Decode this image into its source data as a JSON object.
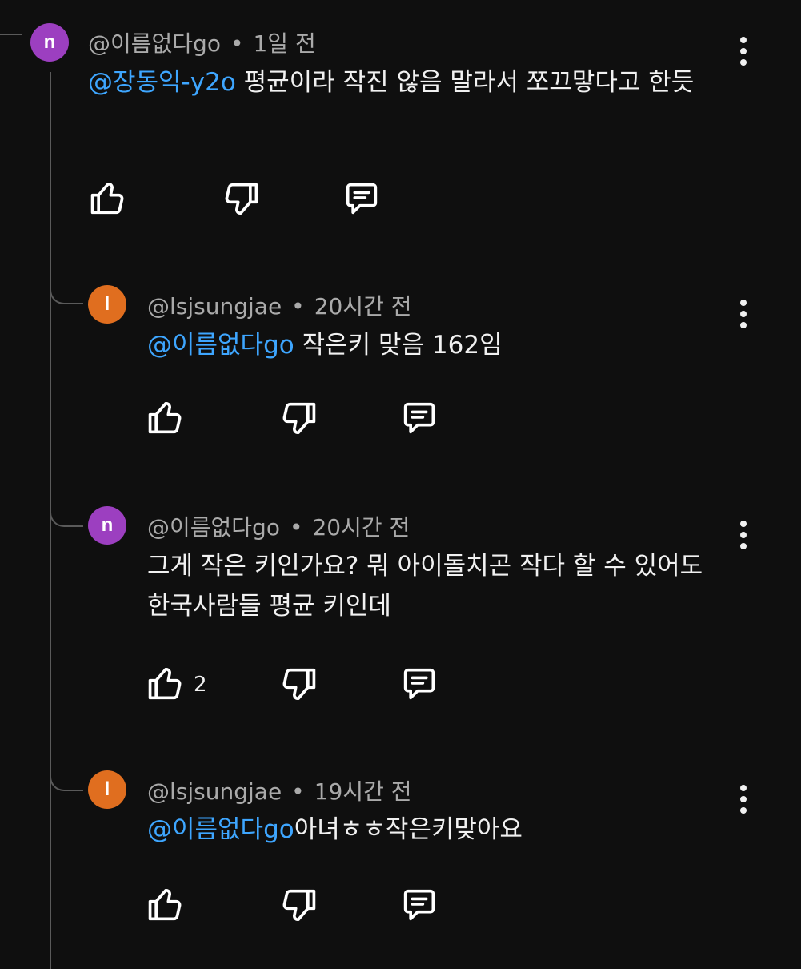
{
  "colors": {
    "background": "#0f0f0f",
    "mention": "#3ea6ff",
    "meta": "#aaaaaa",
    "purple_avatar": "#9c3fc0",
    "orange_avatar": "#e06e1f"
  },
  "comments": [
    {
      "avatar_letter": "n",
      "avatar_color": "#9c3fc0",
      "author": "@이름없다go",
      "separator": "•",
      "time": "1일 전",
      "mention": "@장동익-y2o",
      "text": " 평균이라 작진 않음 말라서 쪼끄맣다고 한듯",
      "like_count": "",
      "icons": [
        "thumbs-up-icon",
        "thumbs-down-icon",
        "reply-icon",
        "more-icon"
      ]
    },
    {
      "avatar_letter": "l",
      "avatar_color": "#e06e1f",
      "author": "@lsjsungjae",
      "separator": "•",
      "time": "20시간 전",
      "mention": "@이름없다go",
      "text": " 작은키 맞음 162임",
      "like_count": ""
    },
    {
      "avatar_letter": "n",
      "avatar_color": "#9c3fc0",
      "author": "@이름없다go",
      "separator": "•",
      "time": "20시간 전",
      "mention": "",
      "text": "그게 작은 키인가요? 뭐 아이돌치곤 작다 할 수 있어도 한국사람들 평균 키인데",
      "like_count": "2"
    },
    {
      "avatar_letter": "l",
      "avatar_color": "#e06e1f",
      "author": "@lsjsungjae",
      "separator": "•",
      "time": "19시간 전",
      "mention": "@이름없다go",
      "text": "아녀ㅎㅎ작은키맞아요",
      "like_count": ""
    }
  ]
}
